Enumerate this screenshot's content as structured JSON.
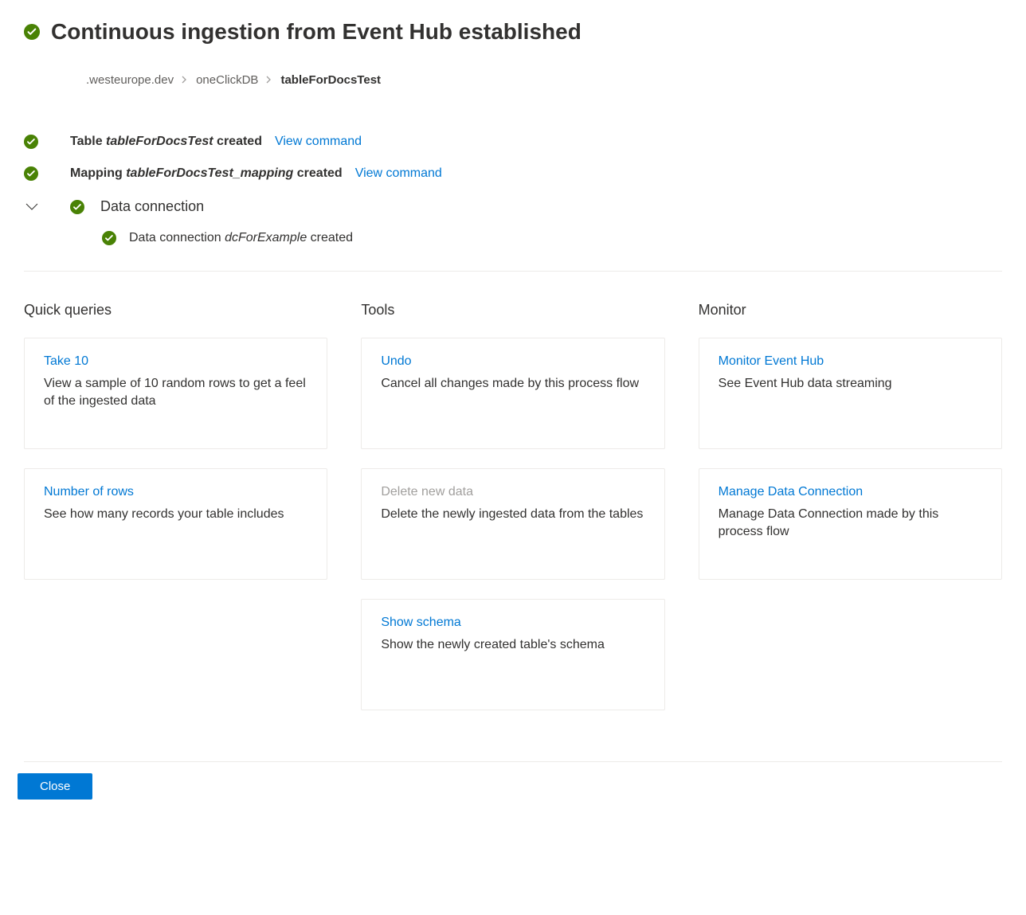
{
  "header": {
    "title": "Continuous ingestion from Event Hub established"
  },
  "breadcrumb": {
    "items": [
      {
        "label": ".westeurope.dev",
        "active": false
      },
      {
        "label": "oneClickDB",
        "active": false
      },
      {
        "label": "tableForDocsTest",
        "active": true
      }
    ]
  },
  "status": {
    "table": {
      "prefix": "Table ",
      "name": "tableForDocsTest",
      "suffix": " created",
      "link": "View command"
    },
    "mapping": {
      "prefix": "Mapping ",
      "name": "tableForDocsTest_mapping",
      "suffix": " created",
      "link": "View command"
    },
    "connection": {
      "label": "Data connection",
      "sub_prefix": "Data connection ",
      "sub_name": "dcForExample",
      "sub_suffix": " created"
    }
  },
  "columns": {
    "quick_queries": {
      "title": "Quick queries",
      "cards": [
        {
          "title": "Take 10",
          "desc": "View a sample of 10 random rows to get a feel of the ingested data",
          "disabled": false
        },
        {
          "title": "Number of rows",
          "desc": "See how many records your table includes",
          "disabled": false
        }
      ]
    },
    "tools": {
      "title": "Tools",
      "cards": [
        {
          "title": "Undo",
          "desc": "Cancel all changes made by this process flow",
          "disabled": false
        },
        {
          "title": "Delete new data",
          "desc": "Delete the newly ingested data from the tables",
          "disabled": true
        },
        {
          "title": "Show schema",
          "desc": "Show the newly created table's schema",
          "disabled": false
        }
      ]
    },
    "monitor": {
      "title": "Monitor",
      "cards": [
        {
          "title": "Monitor Event Hub",
          "desc": "See Event Hub data streaming",
          "disabled": false
        },
        {
          "title": "Manage Data Connection",
          "desc": "Manage Data Connection made by this process flow",
          "disabled": false
        }
      ]
    }
  },
  "footer": {
    "close_label": "Close"
  }
}
